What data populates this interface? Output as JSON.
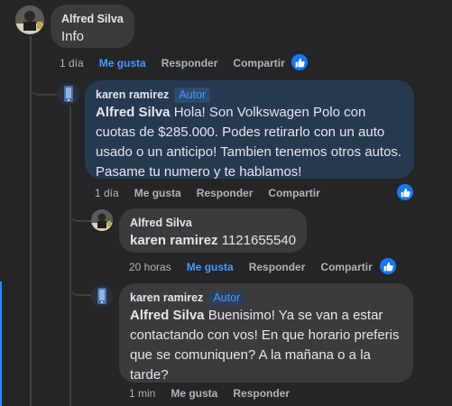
{
  "comments": [
    {
      "author": "Alfred Silva",
      "text": "Info",
      "time": "1 día",
      "like": "Me gusta",
      "reply": "Responder",
      "share": "Compartir",
      "liked": true
    },
    {
      "author": "karen ramirez",
      "badge": "Autor",
      "mention": "Alfred Silva",
      "text": " Hola! Son Volkswagen Polo con cuotas de $285.000. Podes retirarlo con un auto usado o un anticipo! Tambien tenemos otros autos. Pasame tu numero y te hablamos!",
      "time": "1 día",
      "like": "Me gusta",
      "reply": "Responder",
      "share": "Compartir",
      "liked": false
    },
    {
      "author": "Alfred Silva",
      "mention": "karen ramirez",
      "text": " 1121655540",
      "time": "20 horas",
      "like": "Me gusta",
      "reply": "Responder",
      "share": "Compartir",
      "liked": true
    },
    {
      "author": "karen ramirez",
      "badge": "Autor",
      "mention": "Alfred Silva",
      "text": " Buenisimo! Ya se van a estar contactando con vos! En que horario preferis que se comuniquen? A la mañana o a la tarde?",
      "time": "1 min",
      "like": "Me gusta",
      "reply": "Responder",
      "liked": false
    }
  ],
  "colors": {
    "background": "#242526",
    "bubble": "#3a3b3c",
    "author_bubble": "#263951",
    "accent": "#4599ff",
    "muted": "#b0b3b8"
  },
  "icons": {
    "reaction": "thumbs-up-icon"
  }
}
